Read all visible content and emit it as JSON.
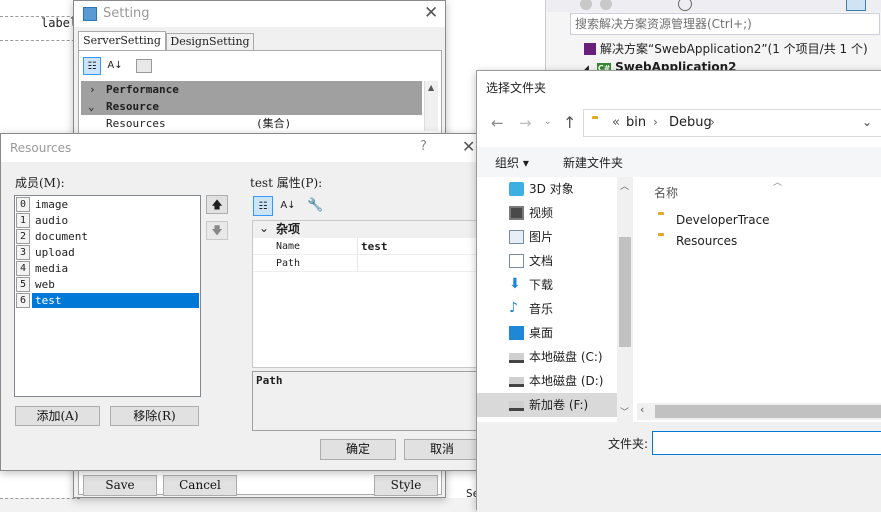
{
  "designer": {
    "label_text": "label"
  },
  "vs": {
    "search_placeholder": "搜索解决方案资源管理器(Ctrl+;)",
    "solution_text": "解决方案“SwebApplication2”(1 个项目/共 1 个)",
    "project_text": "SwebApplication2"
  },
  "setting": {
    "title": "Setting",
    "tabs": [
      "ServerSetting",
      "DesignSetting"
    ],
    "categories": [
      "Performance",
      "Resource"
    ],
    "row_name": "Resources",
    "row_value": "(集合)",
    "save_label": "Save",
    "cancel_label": "Cancel",
    "style_label": "Style"
  },
  "resources": {
    "title": "Resources",
    "help": "?",
    "members_label": "成员(M):",
    "members": [
      {
        "index": "0",
        "name": "image"
      },
      {
        "index": "1",
        "name": "audio"
      },
      {
        "index": "2",
        "name": "document"
      },
      {
        "index": "3",
        "name": "upload"
      },
      {
        "index": "4",
        "name": "media"
      },
      {
        "index": "5",
        "name": "web"
      },
      {
        "index": "6",
        "name": "test"
      }
    ],
    "props_label": "test 属性(P):",
    "category": "杂项",
    "props": [
      {
        "name": "Name",
        "value": "test"
      },
      {
        "name": "Path",
        "value": ""
      }
    ],
    "desc_title": "Path",
    "add_label": "添加(A)",
    "remove_label": "移除(R)",
    "ok_label": "确定",
    "cancel_label": "取消"
  },
  "folder_dialog": {
    "title": "选择文件夹",
    "breadcrumb": [
      "«",
      "bin",
      "Debug"
    ],
    "organize_label": "组织 ▾",
    "new_folder_label": "新建文件夹",
    "nav": [
      {
        "label": "3D 对象",
        "icon": "cube-3d-icon"
      },
      {
        "label": "视频",
        "icon": "video-icon"
      },
      {
        "label": "图片",
        "icon": "pictures-icon"
      },
      {
        "label": "文档",
        "icon": "documents-icon"
      },
      {
        "label": "下载",
        "icon": "download-icon"
      },
      {
        "label": "音乐",
        "icon": "music-icon"
      },
      {
        "label": "桌面",
        "icon": "desktop-icon"
      },
      {
        "label": "本地磁盘 (C:)",
        "icon": "drive-icon"
      },
      {
        "label": "本地磁盘 (D:)",
        "icon": "drive-icon"
      },
      {
        "label": "新加卷 (F:)",
        "icon": "drive-icon"
      }
    ],
    "column_name": "名称",
    "files": [
      "DeveloperTrace",
      "Resources"
    ],
    "folder_label": "文件夹:",
    "folder_value": ""
  },
  "colors": {
    "selection": "#0078d7",
    "category_bar": "#a0a0a0"
  }
}
